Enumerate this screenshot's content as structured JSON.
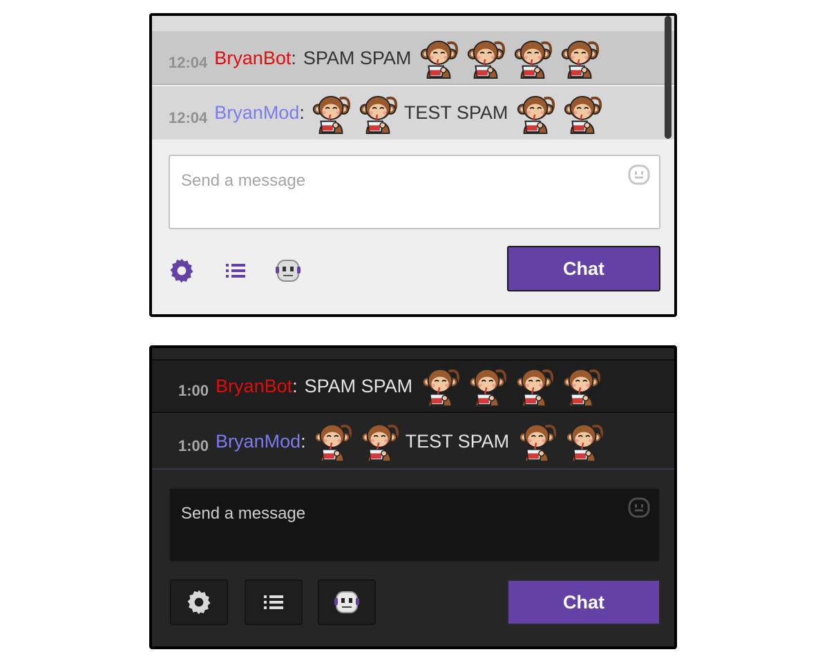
{
  "colors": {
    "accent": "#6441a5",
    "bot_name": "#e00d0d",
    "mod_name": "#7b7bf0"
  },
  "emote_icon": "monkey-drinking-emote",
  "light_panel": {
    "messages": [
      {
        "time": "12:04",
        "user": "BryanBot",
        "colon": ":",
        "text_before": "SPAM SPAM",
        "text_after": ""
      },
      {
        "time": "12:04",
        "user": "BryanMod",
        "colon": ":",
        "text_before": "",
        "text_after": "TEST SPAM"
      }
    ],
    "input_placeholder": "Send a message",
    "chat_button": "Chat"
  },
  "dark_panel": {
    "messages": [
      {
        "time": "1:00",
        "user": "BryanBot",
        "colon": ":",
        "text_before": "SPAM SPAM",
        "text_after": ""
      },
      {
        "time": "1:00",
        "user": "BryanMod",
        "colon": ":",
        "text_before": "",
        "text_after": "TEST SPAM"
      }
    ],
    "input_placeholder": "Send a message",
    "chat_button": "Chat"
  }
}
